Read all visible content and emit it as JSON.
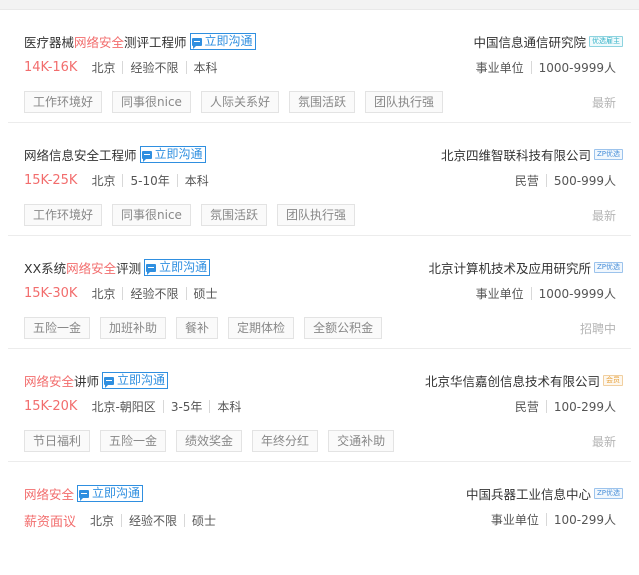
{
  "chat_label": "立即沟通",
  "jobs": [
    {
      "title_pre": "医疗器械",
      "title_hl": "网络安全",
      "title_post": "测评工程师",
      "salary": "14K-16K",
      "city": "北京",
      "experience": "经验不限",
      "education": "本科",
      "tags": [
        "工作环境好",
        "同事很nice",
        "人际关系好",
        "氛围活跃",
        "团队执行强"
      ],
      "company": "中国信息通信研究院",
      "company_badge": "优选雇主",
      "company_badge_color": "#3bb4c9",
      "company_type": "事业单位",
      "company_size": "1000-9999人",
      "status": "最新"
    },
    {
      "title_pre": "网络信息安全工程师",
      "title_hl": "",
      "title_post": "",
      "salary": "15K-25K",
      "city": "北京",
      "experience": "5-10年",
      "education": "本科",
      "tags": [
        "工作环境好",
        "同事很nice",
        "氛围活跃",
        "团队执行强"
      ],
      "company": "北京四维智联科技有限公司",
      "company_badge": "ZP优选",
      "company_badge_color": "#4a90d9",
      "company_type": "民营",
      "company_size": "500-999人",
      "status": "最新"
    },
    {
      "title_pre": "XX系统",
      "title_hl": "网络安全",
      "title_post": "评测",
      "salary": "15K-30K",
      "city": "北京",
      "experience": "经验不限",
      "education": "硕士",
      "tags": [
        "五险一金",
        "加班补助",
        "餐补",
        "定期体检",
        "全额公积金"
      ],
      "company": "北京计算机技术及应用研究所",
      "company_badge": "ZP优选",
      "company_badge_color": "#4a90d9",
      "company_type": "事业单位",
      "company_size": "1000-9999人",
      "status": "招聘中"
    },
    {
      "title_pre": "",
      "title_hl": "网络安全",
      "title_post": "讲师",
      "salary": "15K-20K",
      "city": "北京-朝阳区",
      "experience": "3-5年",
      "education": "本科",
      "tags": [
        "节日福利",
        "五险一金",
        "绩效奖金",
        "年终分红",
        "交通补助"
      ],
      "company": "北京华信嘉创信息技术有限公司",
      "company_badge": "会员",
      "company_badge_color": "#e7a13c",
      "company_type": "民营",
      "company_size": "100-299人",
      "status": "最新"
    },
    {
      "title_pre": "",
      "title_hl": "网络安全",
      "title_post": "",
      "salary": "薪资面议",
      "city": "北京",
      "experience": "经验不限",
      "education": "硕士",
      "tags": [],
      "company": "中国兵器工业信息中心",
      "company_badge": "ZP优选",
      "company_badge_color": "#4a90d9",
      "company_type": "事业单位",
      "company_size": "100-299人",
      "status": ""
    }
  ]
}
